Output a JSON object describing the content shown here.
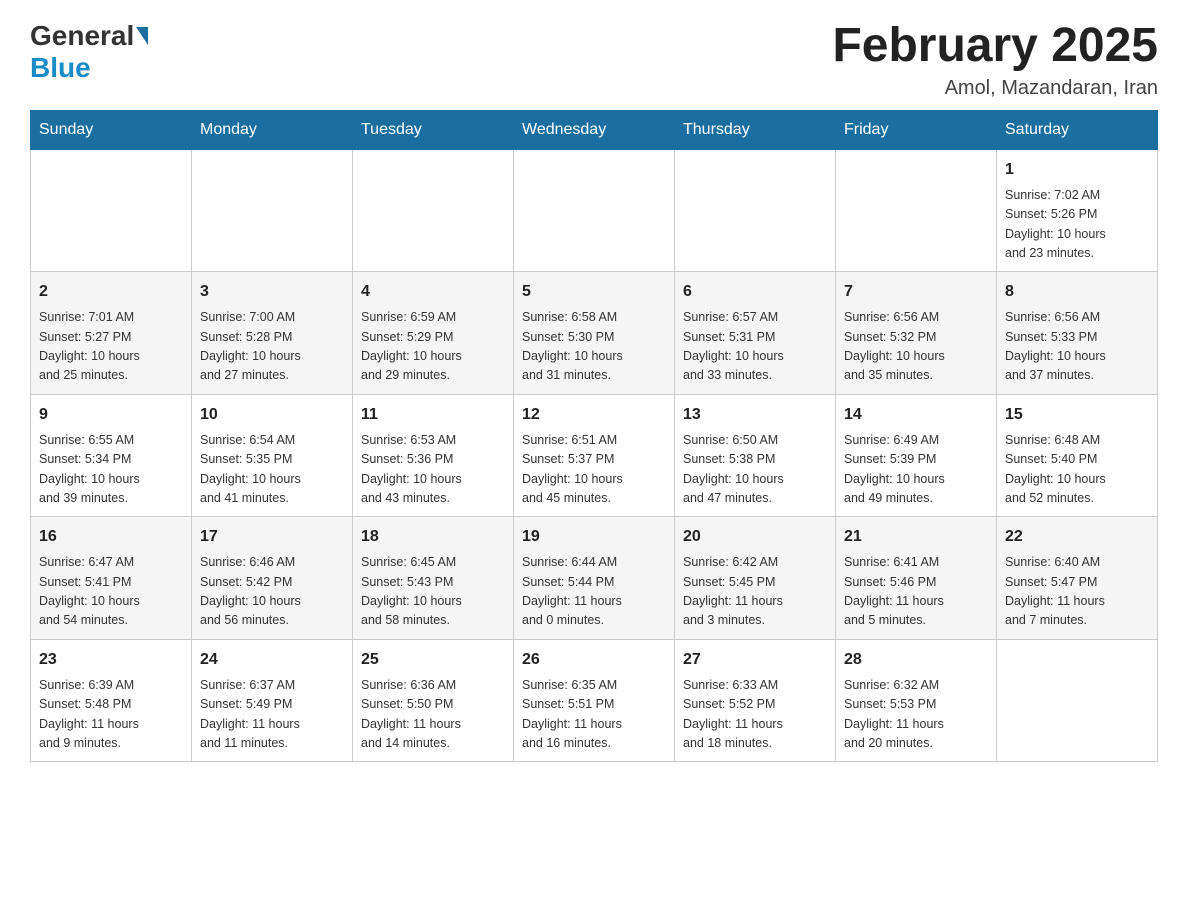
{
  "header": {
    "logo_general": "General",
    "logo_blue": "Blue",
    "month_title": "February 2025",
    "location": "Amol, Mazandaran, Iran"
  },
  "days_of_week": [
    "Sunday",
    "Monday",
    "Tuesday",
    "Wednesday",
    "Thursday",
    "Friday",
    "Saturday"
  ],
  "weeks": [
    {
      "days": [
        {
          "num": "",
          "info": ""
        },
        {
          "num": "",
          "info": ""
        },
        {
          "num": "",
          "info": ""
        },
        {
          "num": "",
          "info": ""
        },
        {
          "num": "",
          "info": ""
        },
        {
          "num": "",
          "info": ""
        },
        {
          "num": "1",
          "info": "Sunrise: 7:02 AM\nSunset: 5:26 PM\nDaylight: 10 hours\nand 23 minutes."
        }
      ]
    },
    {
      "days": [
        {
          "num": "2",
          "info": "Sunrise: 7:01 AM\nSunset: 5:27 PM\nDaylight: 10 hours\nand 25 minutes."
        },
        {
          "num": "3",
          "info": "Sunrise: 7:00 AM\nSunset: 5:28 PM\nDaylight: 10 hours\nand 27 minutes."
        },
        {
          "num": "4",
          "info": "Sunrise: 6:59 AM\nSunset: 5:29 PM\nDaylight: 10 hours\nand 29 minutes."
        },
        {
          "num": "5",
          "info": "Sunrise: 6:58 AM\nSunset: 5:30 PM\nDaylight: 10 hours\nand 31 minutes."
        },
        {
          "num": "6",
          "info": "Sunrise: 6:57 AM\nSunset: 5:31 PM\nDaylight: 10 hours\nand 33 minutes."
        },
        {
          "num": "7",
          "info": "Sunrise: 6:56 AM\nSunset: 5:32 PM\nDaylight: 10 hours\nand 35 minutes."
        },
        {
          "num": "8",
          "info": "Sunrise: 6:56 AM\nSunset: 5:33 PM\nDaylight: 10 hours\nand 37 minutes."
        }
      ]
    },
    {
      "days": [
        {
          "num": "9",
          "info": "Sunrise: 6:55 AM\nSunset: 5:34 PM\nDaylight: 10 hours\nand 39 minutes."
        },
        {
          "num": "10",
          "info": "Sunrise: 6:54 AM\nSunset: 5:35 PM\nDaylight: 10 hours\nand 41 minutes."
        },
        {
          "num": "11",
          "info": "Sunrise: 6:53 AM\nSunset: 5:36 PM\nDaylight: 10 hours\nand 43 minutes."
        },
        {
          "num": "12",
          "info": "Sunrise: 6:51 AM\nSunset: 5:37 PM\nDaylight: 10 hours\nand 45 minutes."
        },
        {
          "num": "13",
          "info": "Sunrise: 6:50 AM\nSunset: 5:38 PM\nDaylight: 10 hours\nand 47 minutes."
        },
        {
          "num": "14",
          "info": "Sunrise: 6:49 AM\nSunset: 5:39 PM\nDaylight: 10 hours\nand 49 minutes."
        },
        {
          "num": "15",
          "info": "Sunrise: 6:48 AM\nSunset: 5:40 PM\nDaylight: 10 hours\nand 52 minutes."
        }
      ]
    },
    {
      "days": [
        {
          "num": "16",
          "info": "Sunrise: 6:47 AM\nSunset: 5:41 PM\nDaylight: 10 hours\nand 54 minutes."
        },
        {
          "num": "17",
          "info": "Sunrise: 6:46 AM\nSunset: 5:42 PM\nDaylight: 10 hours\nand 56 minutes."
        },
        {
          "num": "18",
          "info": "Sunrise: 6:45 AM\nSunset: 5:43 PM\nDaylight: 10 hours\nand 58 minutes."
        },
        {
          "num": "19",
          "info": "Sunrise: 6:44 AM\nSunset: 5:44 PM\nDaylight: 11 hours\nand 0 minutes."
        },
        {
          "num": "20",
          "info": "Sunrise: 6:42 AM\nSunset: 5:45 PM\nDaylight: 11 hours\nand 3 minutes."
        },
        {
          "num": "21",
          "info": "Sunrise: 6:41 AM\nSunset: 5:46 PM\nDaylight: 11 hours\nand 5 minutes."
        },
        {
          "num": "22",
          "info": "Sunrise: 6:40 AM\nSunset: 5:47 PM\nDaylight: 11 hours\nand 7 minutes."
        }
      ]
    },
    {
      "days": [
        {
          "num": "23",
          "info": "Sunrise: 6:39 AM\nSunset: 5:48 PM\nDaylight: 11 hours\nand 9 minutes."
        },
        {
          "num": "24",
          "info": "Sunrise: 6:37 AM\nSunset: 5:49 PM\nDaylight: 11 hours\nand 11 minutes."
        },
        {
          "num": "25",
          "info": "Sunrise: 6:36 AM\nSunset: 5:50 PM\nDaylight: 11 hours\nand 14 minutes."
        },
        {
          "num": "26",
          "info": "Sunrise: 6:35 AM\nSunset: 5:51 PM\nDaylight: 11 hours\nand 16 minutes."
        },
        {
          "num": "27",
          "info": "Sunrise: 6:33 AM\nSunset: 5:52 PM\nDaylight: 11 hours\nand 18 minutes."
        },
        {
          "num": "28",
          "info": "Sunrise: 6:32 AM\nSunset: 5:53 PM\nDaylight: 11 hours\nand 20 minutes."
        },
        {
          "num": "",
          "info": ""
        }
      ]
    }
  ]
}
